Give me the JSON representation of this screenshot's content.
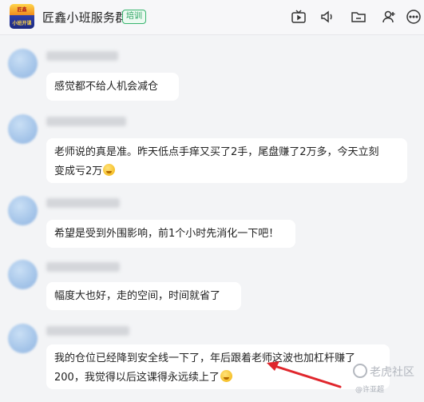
{
  "header": {
    "title": "匠鑫小班服务群",
    "badge": "培训",
    "avatar_top_text": "匠鑫",
    "avatar_bottom_text": "小班开课",
    "icons": [
      "tv-icon",
      "speaker-icon",
      "folder-icon",
      "add-user-icon",
      "more-icon"
    ]
  },
  "messages": [
    {
      "text": "感觉都不给人机会减仓"
    },
    {
      "line1": "老师说的真是准。昨天低点手痒又买了2手，尾盘赚了2万多，今天立刻",
      "line2": "变成亏2万"
    },
    {
      "text": "希望是受到外围影响，前1个小时先消化一下吧！"
    },
    {
      "text": "幅度大也好，走的空间，时间就省了"
    },
    {
      "line1": "我的仓位已经降到安全线一下了，年后跟着老师这波也加杠杆赚了",
      "line2": "200，我觉得以后这课得永远续上了"
    }
  ],
  "watermark": {
    "main": "老虎社区",
    "sub": "@许亚超"
  },
  "colors": {
    "accent_arrow": "#e0262c",
    "badge_green": "#1e9e58",
    "bubble": "#ffffff"
  }
}
